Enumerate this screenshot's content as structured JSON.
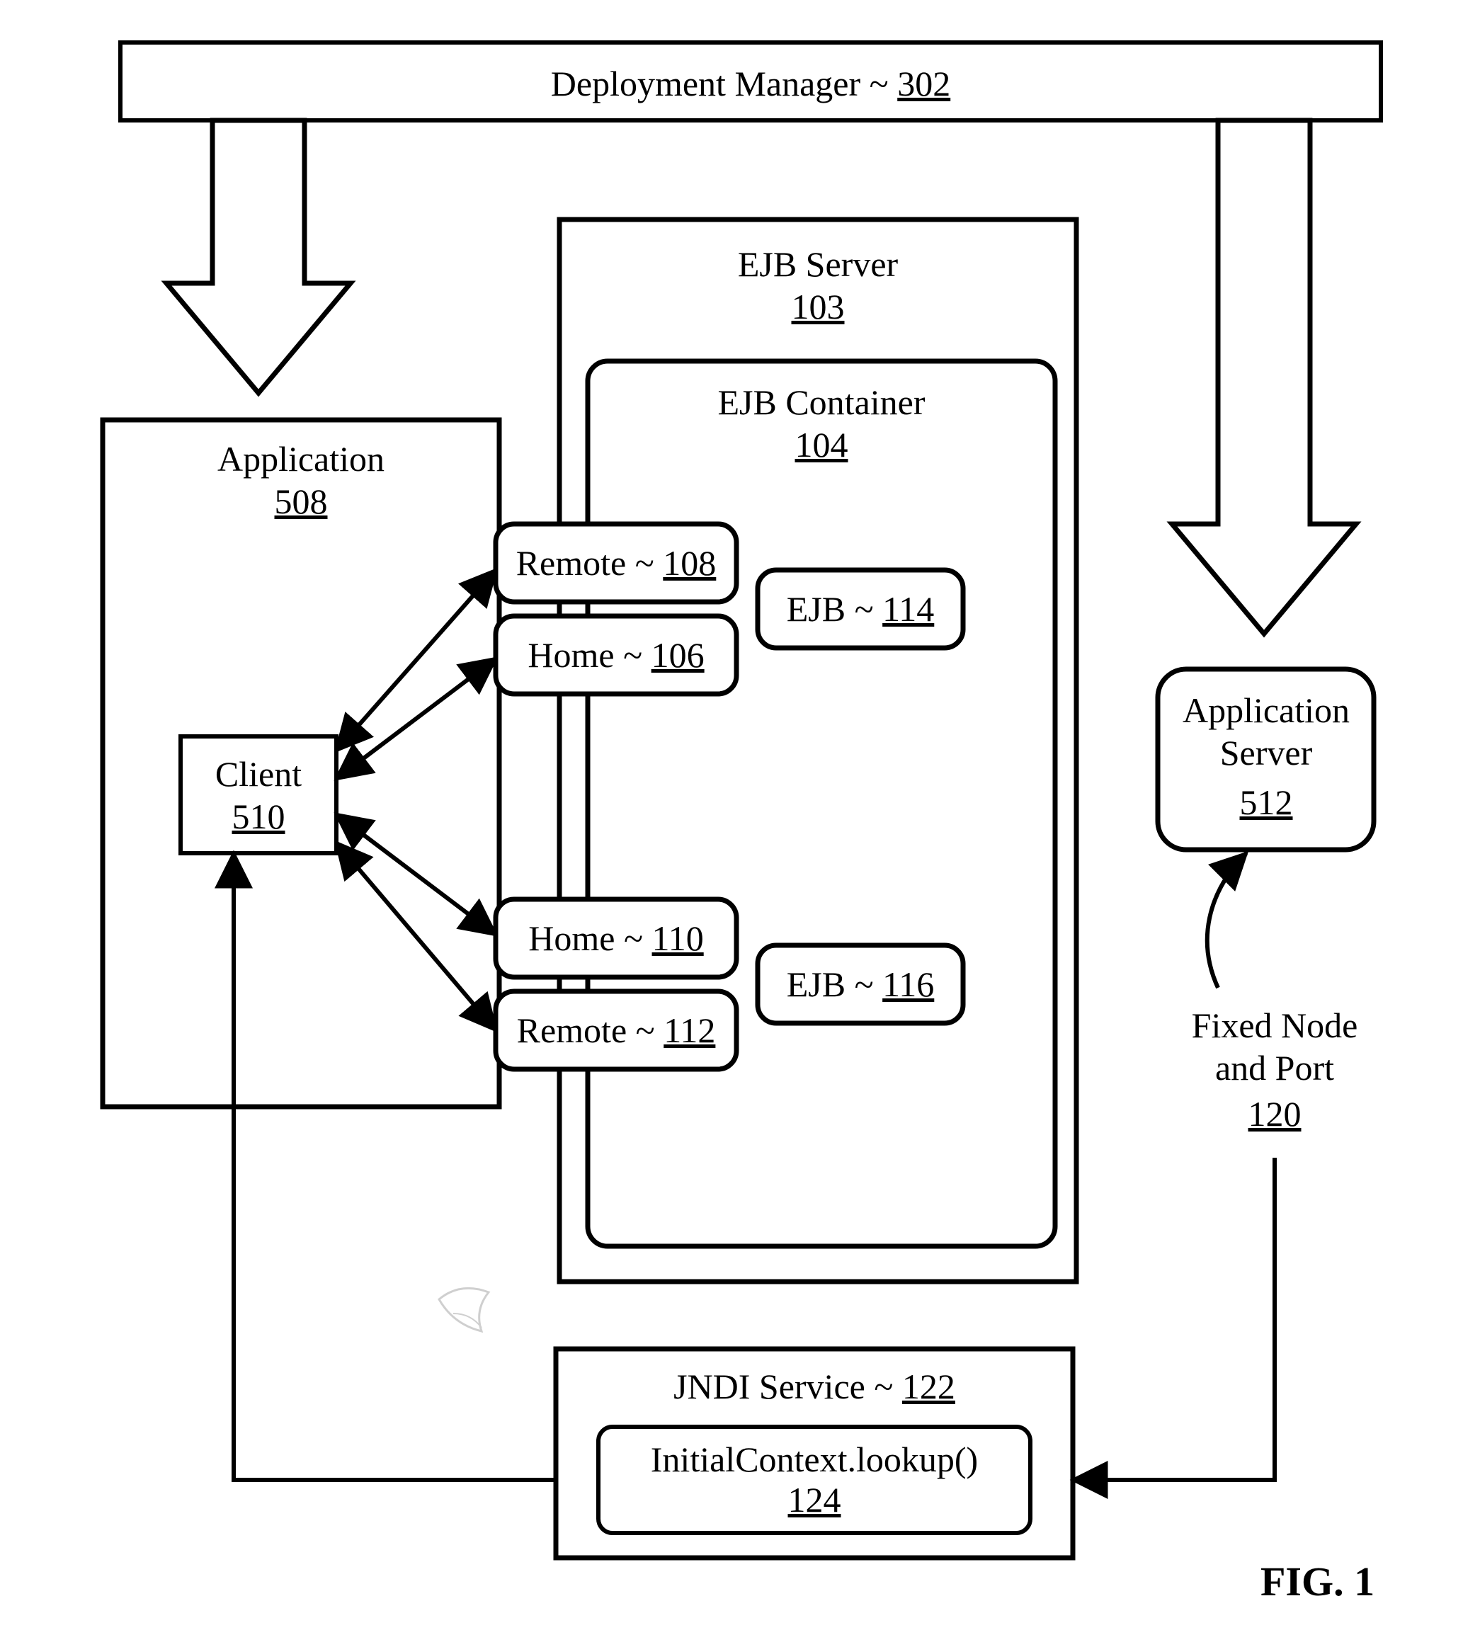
{
  "figure_label": "FIG. 1",
  "deployment_manager": {
    "label": "Deployment Manager",
    "sep": "~",
    "num": "302"
  },
  "ejb_server": {
    "label": "EJB Server",
    "num": "103"
  },
  "ejb_container": {
    "label": "EJB Container",
    "num": "104"
  },
  "application": {
    "label": "Application",
    "num": "508"
  },
  "client": {
    "label": "Client",
    "num": "510"
  },
  "remote1": {
    "label": "Remote",
    "sep": "~",
    "num": "108"
  },
  "home1": {
    "label": "Home",
    "sep": "~",
    "num": "106"
  },
  "home2": {
    "label": "Home",
    "sep": "~",
    "num": "110"
  },
  "remote2": {
    "label": "Remote",
    "sep": "~",
    "num": "112"
  },
  "ejb1": {
    "label": "EJB",
    "sep": "~",
    "num": "114"
  },
  "ejb2": {
    "label": "EJB",
    "sep": "~",
    "num": "116"
  },
  "app_server": {
    "line1": "Application",
    "line2": "Server",
    "num": "512"
  },
  "fixed_node": {
    "line1": "Fixed Node",
    "line2": "and Port",
    "num": "120"
  },
  "jndi_service": {
    "label": "JNDI Service",
    "sep": "~",
    "num": "122"
  },
  "initial_context": {
    "label": "InitialContext.lookup()",
    "num": "124"
  }
}
